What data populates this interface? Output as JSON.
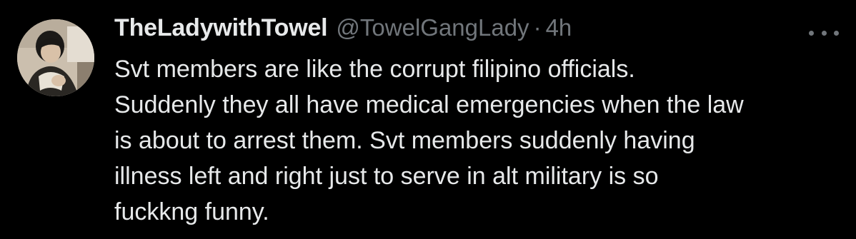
{
  "author": {
    "display_name": "TheLadywithTowel",
    "handle": "@TowelGangLady",
    "separator": "·",
    "timestamp": "4h",
    "avatar_icon": "profile-photo-avatar"
  },
  "actions": {
    "more_icon": "more-options-icon"
  },
  "tweet": {
    "lines": [
      "Svt members are like the corrupt filipino officials.",
      "Suddenly they all have medical emergencies when the law",
      "is about to arrest them. Svt members suddenly having",
      "illness left and right just to serve in alt military is so",
      "fuckkng funny."
    ]
  },
  "colors": {
    "background": "#000000",
    "primary_text": "#e7e9ea",
    "secondary_text": "#71767b"
  }
}
